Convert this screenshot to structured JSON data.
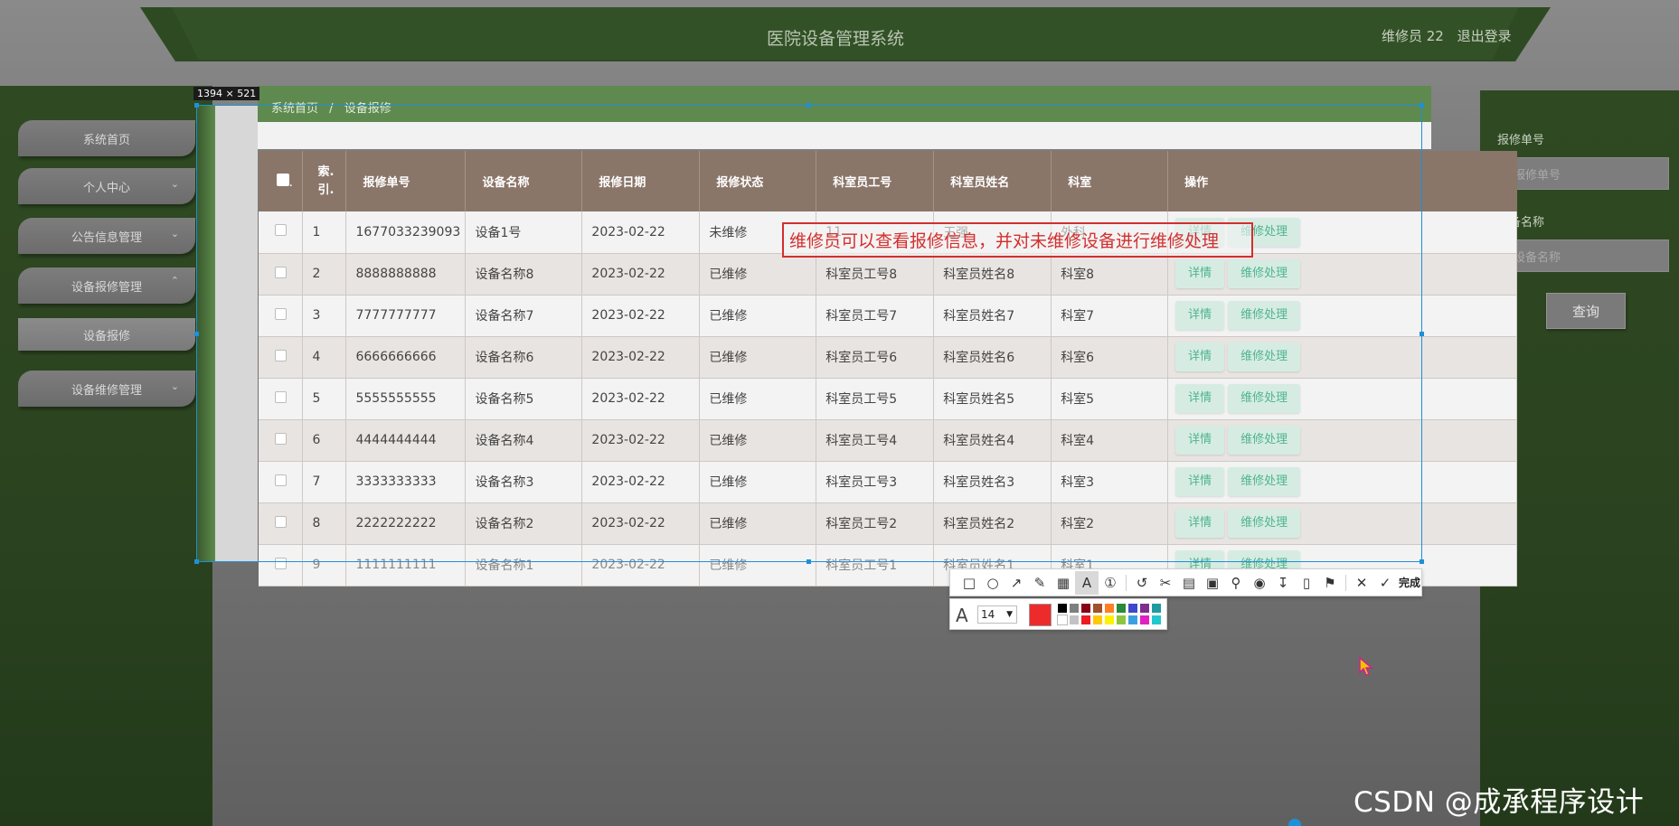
{
  "header": {
    "title": "医院设备管理系统",
    "user": "维修员 22",
    "logout": "退出登录"
  },
  "sidebar": {
    "items": [
      {
        "label": "系统首页"
      },
      {
        "label": "个人中心"
      },
      {
        "label": "公告信息管理"
      },
      {
        "label": "设备报修管理"
      },
      {
        "label": "设备报修"
      },
      {
        "label": "设备维修管理"
      }
    ]
  },
  "breadcrumb": {
    "home": "系统首页",
    "separator": "/",
    "current": "设备报修"
  },
  "search": {
    "repair_no_label": "报修单号",
    "repair_no_placeholder": "报修单号",
    "device_name_label": "设备名称",
    "device_name_placeholder": "设备名称",
    "query_button": "查询"
  },
  "table": {
    "columns": [
      "索引",
      "报修单号",
      "设备名称",
      "报修日期",
      "报修状态",
      "科室员工号",
      "科室员姓名",
      "科室",
      "操作"
    ],
    "index_header_line1": "索.",
    "index_header_line2": "引.",
    "rows": [
      {
        "index": "1",
        "no": "1677033239093",
        "device": "设备1号",
        "date": "2023-02-22",
        "status": "未维修",
        "staff_id": "11",
        "staff_name": "王强",
        "dept": "外科"
      },
      {
        "index": "2",
        "no": "8888888888",
        "device": "设备名称8",
        "date": "2023-02-22",
        "status": "已维修",
        "staff_id": "科室员工号8",
        "staff_name": "科室员姓名8",
        "dept": "科室8"
      },
      {
        "index": "3",
        "no": "7777777777",
        "device": "设备名称7",
        "date": "2023-02-22",
        "status": "已维修",
        "staff_id": "科室员工号7",
        "staff_name": "科室员姓名7",
        "dept": "科室7"
      },
      {
        "index": "4",
        "no": "6666666666",
        "device": "设备名称6",
        "date": "2023-02-22",
        "status": "已维修",
        "staff_id": "科室员工号6",
        "staff_name": "科室员姓名6",
        "dept": "科室6"
      },
      {
        "index": "5",
        "no": "5555555555",
        "device": "设备名称5",
        "date": "2023-02-22",
        "status": "已维修",
        "staff_id": "科室员工号5",
        "staff_name": "科室员姓名5",
        "dept": "科室5"
      },
      {
        "index": "6",
        "no": "4444444444",
        "device": "设备名称4",
        "date": "2023-02-22",
        "status": "已维修",
        "staff_id": "科室员工号4",
        "staff_name": "科室员姓名4",
        "dept": "科室4"
      },
      {
        "index": "7",
        "no": "3333333333",
        "device": "设备名称3",
        "date": "2023-02-22",
        "status": "已维修",
        "staff_id": "科室员工号3",
        "staff_name": "科室员姓名3",
        "dept": "科室3"
      },
      {
        "index": "8",
        "no": "2222222222",
        "device": "设备名称2",
        "date": "2023-02-22",
        "status": "已维修",
        "staff_id": "科室员工号2",
        "staff_name": "科室员姓名2",
        "dept": "科室2"
      },
      {
        "index": "9",
        "no": "1111111111",
        "device": "设备名称1",
        "date": "2023-02-22",
        "status": "已维修",
        "staff_id": "科室员工号1",
        "staff_name": "科室员姓名1",
        "dept": "科室1"
      }
    ],
    "detail_button": "详情",
    "repair_button": "维修处理"
  },
  "annotation": {
    "text": "维修员可以查看报修信息，并对未维修设备进行维修处理"
  },
  "screenshot_tool": {
    "size_label": "1394 × 521",
    "done_label": "完成",
    "font_size": "14",
    "current_color": "#ee2b2b",
    "swatches": [
      "#000000",
      "#7f7f7f",
      "#880015",
      "#a0522d",
      "#ff7f27",
      "#2a8a3a",
      "#3f48cc",
      "#7d2f8c",
      "#1f9aa0",
      "#ffffff",
      "#c3c3c3",
      "#ed1c24",
      "#ffc90e",
      "#fff200",
      "#8cc63f",
      "#3ca0e0",
      "#e020c0",
      "#20c8d0"
    ]
  },
  "watermark": "CSDN @成承程序设计"
}
